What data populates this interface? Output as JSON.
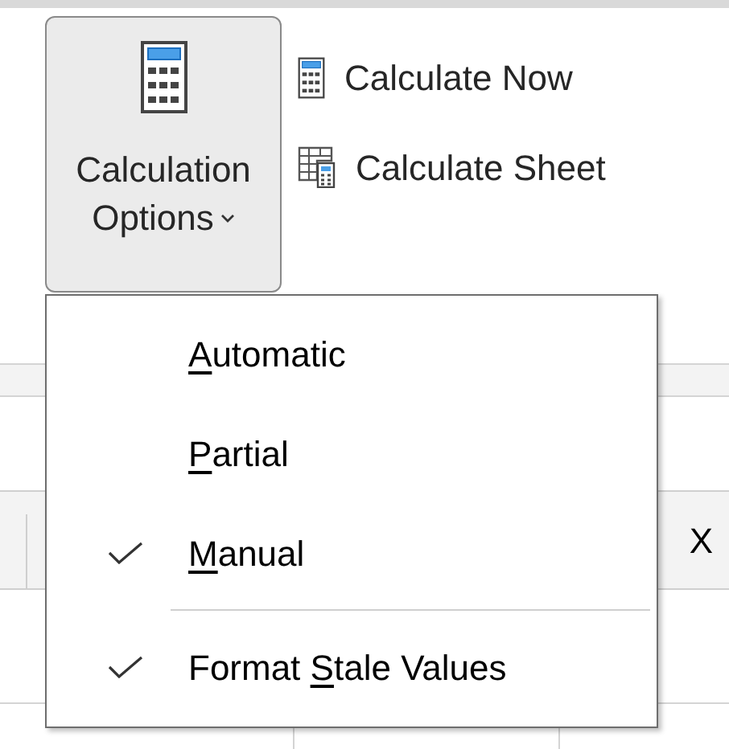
{
  "ribbon": {
    "options_button": {
      "label_line_1": "Calculation",
      "label_line_2": "Options",
      "pressed": true
    },
    "commands": [
      {
        "kind": "calculator",
        "label": "Calculate Now"
      },
      {
        "kind": "sheet",
        "label": "Calculate Sheet"
      }
    ]
  },
  "sheet": {
    "column_header": "X"
  },
  "menu": {
    "items": [
      {
        "kind": "option",
        "access_key": "A",
        "label_after": "utomatic",
        "checked": false
      },
      {
        "kind": "option",
        "access_key": "P",
        "label_after": "artial",
        "checked": false
      },
      {
        "kind": "option",
        "access_key": "M",
        "label_after": "anual",
        "checked": true
      },
      {
        "kind": "separator"
      },
      {
        "kind": "option",
        "label_before": "Format ",
        "access_key": "S",
        "label_after": "tale Values",
        "checked": true
      }
    ]
  }
}
